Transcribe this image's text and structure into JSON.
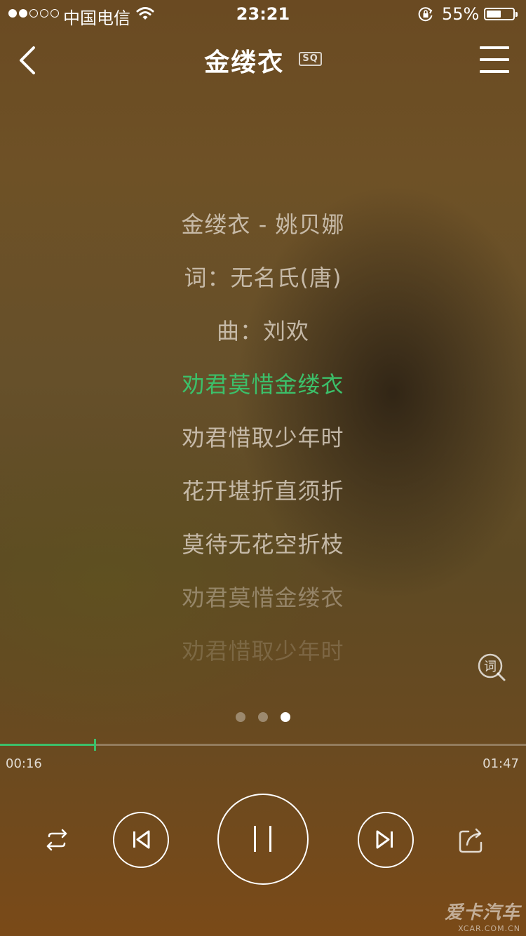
{
  "status_bar": {
    "signal_bars_filled": 2,
    "signal_bars_total": 5,
    "carrier": "中国电信",
    "time": "23:21",
    "battery_percent": "55%",
    "battery_level": 0.55
  },
  "nav": {
    "back_icon": "chevron-left-icon",
    "title": "金缕衣",
    "quality_badge": "SQ",
    "menu_icon": "hamburger-menu-icon"
  },
  "lyrics": [
    {
      "text": "金缕衣 - 姚贝娜",
      "state": "normal"
    },
    {
      "text": "词：无名氏(唐)",
      "state": "normal"
    },
    {
      "text": "曲：刘欢",
      "state": "normal"
    },
    {
      "text": "劝君莫惜金缕衣",
      "state": "active"
    },
    {
      "text": "劝君惜取少年时",
      "state": "normal"
    },
    {
      "text": "花开堪折直须折",
      "state": "normal"
    },
    {
      "text": "莫待无花空折枝",
      "state": "normal"
    },
    {
      "text": "劝君莫惜金缕衣",
      "state": "fade1"
    },
    {
      "text": "劝君惜取少年时",
      "state": "fade2"
    }
  ],
  "lyric_button": {
    "label": "词"
  },
  "pager": {
    "count": 3,
    "active_index": 2
  },
  "progress": {
    "current_time": "00:16",
    "total_time": "01:47",
    "played_fraction": 0.18
  },
  "controls": {
    "repeat_icon": "repeat-icon",
    "prev_icon": "previous-track-icon",
    "play_state_icon": "pause-icon",
    "next_icon": "next-track-icon",
    "share_icon": "share-icon"
  },
  "watermark": {
    "cn": "爱卡汽车",
    "en": "XCAR.COM.CN"
  },
  "colors": {
    "accent": "#3cc06a",
    "text": "#ffffff"
  }
}
